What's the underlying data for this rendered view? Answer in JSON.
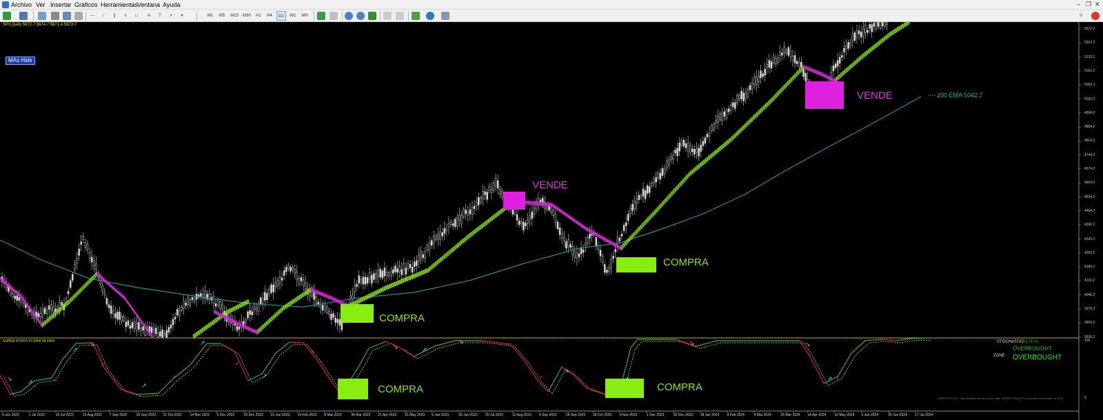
{
  "menu": [
    "Archivo",
    "Ver",
    "Insertar",
    "Gráficos",
    "Herramientas",
    "Ventana",
    "Ayuda"
  ],
  "toolbar": {
    "timeframes": [
      "M1",
      "M5",
      "M15",
      "M30",
      "H1",
      "H4",
      "D1",
      "W1",
      "MN"
    ],
    "active_timeframe": "D1"
  },
  "chart": {
    "symbol_info": "SPX,Daily  5672.7 5674.7 5671.4 5673.7",
    "mas_hide_button": "MAs Hide",
    "ema_label": "200 EMA 5042.7",
    "signals": [
      {
        "text": "VENDE",
        "color": "#e030e0"
      },
      {
        "text": "VENDE",
        "color": "#e030e0"
      },
      {
        "text": "COMPRA",
        "color": "#8ee21c"
      },
      {
        "text": "COMPRA",
        "color": "#8ee21c"
      }
    ],
    "price_axis": [
      "5372.2",
      "5302.2",
      "5232.2",
      "5162.2",
      "5092.2",
      "5022.2",
      "4954.2",
      "4884.2",
      "4814.2",
      "4744.2",
      "4674.2",
      "4604.2",
      "4534.2",
      "4464.2",
      "4396.2",
      "4326.2",
      "4256.2",
      "4186.2",
      "4116.2",
      "4046.2",
      "3976.2",
      "3906.2",
      "3836.2"
    ],
    "date_axis": [
      "9 Jun 2022",
      "1 Jul 2022",
      "25 Jul 2022",
      "16 Aug 2022",
      "7 Sep 2022",
      "29 Sep 2022",
      "21 Oct 2022",
      "14 Nov 2022",
      "6 Dec 2022",
      "29 Dec 2022",
      "23 Jan 2023",
      "14 Feb 2023",
      "8 Mar 2023",
      "30 Mar 2023",
      "21 Apr 2023",
      "15 May 2023",
      "6 Jun 2023",
      "28 Jun 2023",
      "20 Jul 2023",
      "11 Aug 2023",
      "4 Sep 2023",
      "26 Sep 2023",
      "18 Oct 2023",
      "9 Nov 2023",
      "1 Dec 2023",
      "26 Dec 2023",
      "18 Jan 2024",
      "9 Feb 2024",
      "4 Mar 2024",
      "26 Mar 2024",
      "18 Apr 2024",
      "10 May 2024",
      "3 Jun 2024",
      "25 Jun 2024",
      "17 Jul 2024"
    ]
  },
  "indicator": {
    "title": "SUPER STOCH 97.0268 98.2410",
    "scale_top": "100",
    "scale_bottom": "0",
    "stochastic_label": "STOCHASTIC",
    "stochastic_value": "60.74 %",
    "stochastic_state": "OVERBOUGHT",
    "zone_label": "ZONE",
    "zone_state": "OVERBOUGHT",
    "signals": [
      {
        "text": "COMPRA",
        "color": "#8ee21c"
      },
      {
        "text": "COMPRA",
        "color": "#8ee21c"
      }
    ],
    "footer": "SUPER STOCH - This indicator ist free not for sale! SUPER STOCH™ Developed by thetrader in 2024"
  },
  "colors": {
    "bullish_ma": "#8ee21c",
    "bearish_ma": "#cc28cc",
    "ema200": "#1f8f96",
    "candles": "#d8d8d8",
    "stoch_up": "#2fb02f",
    "stoch_down": "#d42020"
  }
}
